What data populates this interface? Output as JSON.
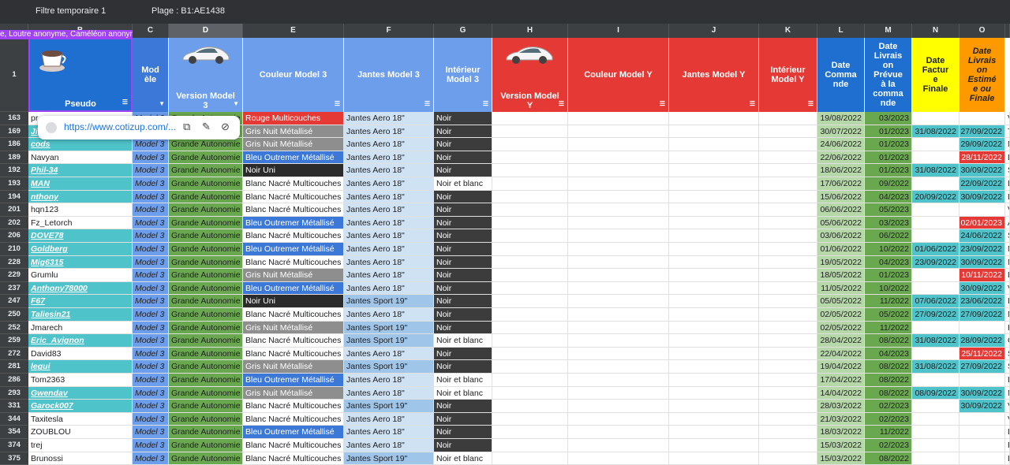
{
  "topbar": {
    "filter_label": "Filtre temporaire 1",
    "range_label": "Plage :   B1:AE1438"
  },
  "collaborators_chip": "e, Loutre anonyme, Caméléon anonyme",
  "col_letters": [
    "",
    "B",
    "C",
    "D",
    "E",
    "F",
    "G",
    "H",
    "I",
    "J",
    "K",
    "L",
    "M",
    "N",
    "O",
    ""
  ],
  "header_row_number": "1",
  "headers": {
    "pseudo": "Pseudo",
    "modele": "Mod\nèle",
    "version3": "Version Model\n3",
    "couleur3": "Couleur Model 3",
    "jantes3": "Jantes Model 3",
    "interieur3": "Intérieur\nModel 3",
    "versionY": "Version Model\nY",
    "couleurY": "Couleur Model Y",
    "jantesY": "Jantes Model Y",
    "interieurY": "Intérieur\nModel Y",
    "dateCmd": "Date\nComma\nnde",
    "dateLivPrev": "Date\nLivrais\non\nPrévue\nà la\ncomma\nnde",
    "dateFact": "Date\nFactur\ne\nFinale",
    "dateLivEst": "Date\nLivrais\non\nEstimé\ne ou\nFinale"
  },
  "popup": {
    "url": "https://www.cotizup.com/..."
  },
  "rows": [
    {
      "n": "163",
      "pseudo": "pr",
      "link": false,
      "m": "Model 3",
      "v": "Grande Autonomie",
      "c": "Rouge Multicouches",
      "cc": "#e53935",
      "cw": true,
      "j": "Jantes Aero 18\"",
      "jc": "#cfe2f3",
      "i": "Noir",
      "ic": "#3c3c3c",
      "iw": true,
      "dc": "19/08/2022",
      "dl": "03/2023",
      "df": "",
      "dfc": "",
      "de": "",
      "dec": "",
      "x": "V"
    },
    {
      "n": "169",
      "pseudo": "Ji",
      "link": true,
      "m": "Model 3",
      "v": "Grande Autonomie",
      "c": "Gris Nuit Métallisé",
      "cc": "#8e8e8e",
      "cw": true,
      "j": "Jantes Aero 18\"",
      "jc": "#cfe2f3",
      "i": "Noir",
      "ic": "#3c3c3c",
      "iw": true,
      "dc": "30/07/2022",
      "dl": "01/2023",
      "df": "31/08/2022",
      "dfc": "#4ec3c9",
      "de": "27/09/2022",
      "dec": "#4ec3c9",
      "x": "T"
    },
    {
      "n": "186",
      "pseudo": "cods",
      "link": true,
      "m": "Model 3",
      "v": "Grande Autonomie",
      "c": "Gris Nuit Métallisé",
      "cc": "#8e8e8e",
      "cw": true,
      "j": "Jantes Aero 18\"",
      "jc": "#cfe2f3",
      "i": "Noir",
      "ic": "#3c3c3c",
      "iw": true,
      "dc": "24/06/2022",
      "dl": "01/2023",
      "df": "",
      "dfc": "",
      "de": "29/09/2022",
      "dec": "#4ec3c9",
      "x": "M"
    },
    {
      "n": "189",
      "pseudo": "Navyan",
      "link": false,
      "m": "Model 3",
      "v": "Grande Autonomie",
      "c": "Bleu Outremer Métallisé",
      "cc": "#3c78d8",
      "cw": true,
      "j": "Jantes Aero 18\"",
      "jc": "#cfe2f3",
      "i": "Noir",
      "ic": "#3c3c3c",
      "iw": true,
      "dc": "22/06/2022",
      "dl": "01/2023",
      "df": "",
      "dfc": "",
      "de": "28/11/2022",
      "dec": "#e53935",
      "x": "L"
    },
    {
      "n": "192",
      "pseudo": "Phil-34",
      "link": true,
      "m": "Model 3",
      "v": "Grande Autonomie",
      "c": "Noir Uni",
      "cc": "#2b2b2b",
      "cw": true,
      "j": "Jantes Aero 18\"",
      "jc": "#cfe2f3",
      "i": "Noir",
      "ic": "#3c3c3c",
      "iw": true,
      "dc": "18/06/2022",
      "dl": "01/2023",
      "df": "31/08/2022",
      "dfc": "#4ec3c9",
      "de": "30/09/2022",
      "dec": "#4ec3c9",
      "x": "S"
    },
    {
      "n": "193",
      "pseudo": "MAN",
      "link": true,
      "m": "Model 3",
      "v": "Grande Autonomie",
      "c": "Blanc Nacré Multicouches",
      "cc": "#ffffff",
      "cw": false,
      "j": "Jantes Aero 18\"",
      "jc": "#cfe2f3",
      "i": "Noir et blanc",
      "ic": "#ffffff",
      "iw": false,
      "dc": "17/06/2022",
      "dl": "09/2022",
      "df": "",
      "dfc": "",
      "de": "22/09/2022",
      "dec": "#4ec3c9",
      "x": "L"
    },
    {
      "n": "194",
      "pseudo": "nthony",
      "link": true,
      "m": "Model 3",
      "v": "Grande Autonomie",
      "c": "Blanc Nacré Multicouches",
      "cc": "#ffffff",
      "cw": false,
      "j": "Jantes Aero 18\"",
      "jc": "#cfe2f3",
      "i": "Noir",
      "ic": "#3c3c3c",
      "iw": true,
      "dc": "15/06/2022",
      "dl": "04/2023",
      "df": "20/09/2022",
      "dfc": "#4ec3c9",
      "de": "30/09/2022",
      "dec": "#4ec3c9",
      "x": "L"
    },
    {
      "n": "201",
      "pseudo": "hqn123",
      "link": false,
      "m": "Model 3",
      "v": "Grande Autonomie",
      "c": "Blanc Nacré Multicouches",
      "cc": "#ffffff",
      "cw": false,
      "j": "Jantes Aero 18\"",
      "jc": "#cfe2f3",
      "i": "Noir",
      "ic": "#3c3c3c",
      "iw": true,
      "dc": "06/06/2022",
      "dl": "05/2023",
      "df": "",
      "dfc": "",
      "de": "",
      "dec": "",
      "x": "V"
    },
    {
      "n": "202",
      "pseudo": "Fz_Letorch",
      "link": false,
      "m": "Model 3",
      "v": "Grande Autonomie",
      "c": "Bleu Outremer Métallisé",
      "cc": "#3c78d8",
      "cw": true,
      "j": "Jantes Aero 18\"",
      "jc": "#cfe2f3",
      "i": "Noir",
      "ic": "#3c3c3c",
      "iw": true,
      "dc": "05/06/2022",
      "dl": "03/2023",
      "df": "",
      "dfc": "",
      "de": "02/01/2023",
      "dec": "#e53935",
      "x": "A"
    },
    {
      "n": "206",
      "pseudo": "DOVE78",
      "link": true,
      "m": "Model 3",
      "v": "Grande Autonomie",
      "c": "Blanc Nacré Multicouches",
      "cc": "#ffffff",
      "cw": false,
      "j": "Jantes Aero 18\"",
      "jc": "#cfe2f3",
      "i": "Noir",
      "ic": "#3c3c3c",
      "iw": true,
      "dc": "03/06/2022",
      "dl": "06/2022",
      "df": "",
      "dfc": "",
      "de": "24/06/2022",
      "dec": "#4ec3c9",
      "x": "S"
    },
    {
      "n": "210",
      "pseudo": "Goldberg",
      "link": true,
      "m": "Model 3",
      "v": "Grande Autonomie",
      "c": "Bleu Outremer Métallisé",
      "cc": "#3c78d8",
      "cw": true,
      "j": "Jantes Aero 18\"",
      "jc": "#cfe2f3",
      "i": "Noir",
      "ic": "#3c3c3c",
      "iw": true,
      "dc": "01/06/2022",
      "dl": "10/2022",
      "df": "01/06/2022",
      "dfc": "#4ec3c9",
      "de": "23/09/2022",
      "dec": "#4ec3c9",
      "x": "N"
    },
    {
      "n": "228",
      "pseudo": "Mig6315",
      "link": true,
      "m": "Model 3",
      "v": "Grande Autonomie",
      "c": "Blanc Nacré Multicouches",
      "cc": "#ffffff",
      "cw": false,
      "j": "Jantes Aero 18\"",
      "jc": "#cfe2f3",
      "i": "Noir",
      "ic": "#3c3c3c",
      "iw": true,
      "dc": "19/05/2022",
      "dl": "04/2023",
      "df": "23/09/2022",
      "dfc": "#4ec3c9",
      "de": "30/09/2022",
      "dec": "#4ec3c9",
      "x": "N"
    },
    {
      "n": "229",
      "pseudo": "Grumlu",
      "link": false,
      "m": "Model 3",
      "v": "Grande Autonomie",
      "c": "Gris Nuit Métallisé",
      "cc": "#8e8e8e",
      "cw": true,
      "j": "Jantes Aero 18\"",
      "jc": "#cfe2f3",
      "i": "Noir",
      "ic": "#3c3c3c",
      "iw": true,
      "dc": "18/05/2022",
      "dl": "01/2023",
      "df": "",
      "dfc": "",
      "de": "10/11/2022",
      "dec": "#e53935",
      "x": "L"
    },
    {
      "n": "237",
      "pseudo": "Anthony78000",
      "link": true,
      "m": "Model 3",
      "v": "Grande Autonomie",
      "c": "Bleu Outremer Métallisé",
      "cc": "#3c78d8",
      "cw": true,
      "j": "Jantes Aero 18\"",
      "jc": "#cfe2f3",
      "i": "Noir",
      "ic": "#3c3c3c",
      "iw": true,
      "dc": "11/05/2022",
      "dl": "10/2022",
      "df": "",
      "dfc": "",
      "de": "30/09/2022",
      "dec": "#4ec3c9",
      "x": "V"
    },
    {
      "n": "247",
      "pseudo": "F67",
      "link": true,
      "m": "Model 3",
      "v": "Grande Autonomie",
      "c": "Noir Uni",
      "cc": "#2b2b2b",
      "cw": true,
      "j": "Jantes Sport 19\"",
      "jc": "#9fc5e8",
      "i": "Noir",
      "ic": "#3c3c3c",
      "iw": true,
      "dc": "05/05/2022",
      "dl": "11/2022",
      "df": "07/06/2022",
      "dfc": "#4ec3c9",
      "de": "23/06/2022",
      "dec": "#4ec3c9",
      "x": "L"
    },
    {
      "n": "250",
      "pseudo": "Taliesin21",
      "link": true,
      "m": "Model 3",
      "v": "Grande Autonomie",
      "c": "Blanc Nacré Multicouches",
      "cc": "#ffffff",
      "cw": false,
      "j": "Jantes Aero 18\"",
      "jc": "#cfe2f3",
      "i": "Noir",
      "ic": "#3c3c3c",
      "iw": true,
      "dc": "02/05/2022",
      "dl": "05/2022",
      "df": "27/09/2022",
      "dfc": "#4ec3c9",
      "de": "27/09/2022",
      "dec": "#4ec3c9",
      "x": "N"
    },
    {
      "n": "252",
      "pseudo": "Jmarech",
      "link": false,
      "m": "Model 3",
      "v": "Grande Autonomie",
      "c": "Gris Nuit Métallisé",
      "cc": "#8e8e8e",
      "cw": true,
      "j": "Jantes Sport 19\"",
      "jc": "#9fc5e8",
      "i": "Noir",
      "ic": "#3c3c3c",
      "iw": true,
      "dc": "02/05/2022",
      "dl": "11/2022",
      "df": "",
      "dfc": "",
      "de": "",
      "dec": "",
      "x": "H"
    },
    {
      "n": "259",
      "pseudo": "Eric_Avignon",
      "link": true,
      "m": "Model 3",
      "v": "Grande Autonomie",
      "c": "Blanc Nacré Multicouches",
      "cc": "#ffffff",
      "cw": false,
      "j": "Jantes Sport 19\"",
      "jc": "#9fc5e8",
      "i": "Noir et blanc",
      "ic": "#ffffff",
      "iw": false,
      "dc": "28/04/2022",
      "dl": "08/2022",
      "df": "31/08/2022",
      "dfc": "#4ec3c9",
      "de": "28/09/2022",
      "dec": "#4ec3c9",
      "x": "C"
    },
    {
      "n": "272",
      "pseudo": "David83",
      "link": false,
      "m": "Model 3",
      "v": "Grande Autonomie",
      "c": "Blanc Nacré Multicouches",
      "cc": "#ffffff",
      "cw": false,
      "j": "Jantes Aero 18\"",
      "jc": "#cfe2f3",
      "i": "Noir",
      "ic": "#3c3c3c",
      "iw": true,
      "dc": "22/04/2022",
      "dl": "04/2023",
      "df": "",
      "dfc": "",
      "de": "25/11/2022",
      "dec": "#e53935",
      "x": "S"
    },
    {
      "n": "281",
      "pseudo": "legui",
      "link": true,
      "m": "Model 3",
      "v": "Grande Autonomie",
      "c": "Gris Nuit Métallisé",
      "cc": "#8e8e8e",
      "cw": true,
      "j": "Jantes Sport 19\"",
      "jc": "#9fc5e8",
      "i": "Noir",
      "ic": "#3c3c3c",
      "iw": true,
      "dc": "19/04/2022",
      "dl": "08/2022",
      "df": "31/08/2022",
      "dfc": "#4ec3c9",
      "de": "27/09/2022",
      "dec": "#4ec3c9",
      "x": "S"
    },
    {
      "n": "286",
      "pseudo": "Tom2363",
      "link": false,
      "m": "Model 3",
      "v": "Grande Autonomie",
      "c": "Bleu Outremer Métallisé",
      "cc": "#3c78d8",
      "cw": true,
      "j": "Jantes Aero 18\"",
      "jc": "#cfe2f3",
      "i": "Noir et blanc",
      "ic": "#ffffff",
      "iw": false,
      "dc": "17/04/2022",
      "dl": "08/2022",
      "df": "",
      "dfc": "",
      "de": "",
      "dec": "",
      "x": "L"
    },
    {
      "n": "293",
      "pseudo": "Gwendav",
      "link": true,
      "m": "Model 3",
      "v": "Grande Autonomie",
      "c": "Gris Nuit Métallisé",
      "cc": "#8e8e8e",
      "cw": true,
      "j": "Jantes Aero 18\"",
      "jc": "#cfe2f3",
      "i": "Noir et blanc",
      "ic": "#ffffff",
      "iw": false,
      "dc": "14/04/2022",
      "dl": "08/2022",
      "df": "08/09/2022",
      "dfc": "#4ec3c9",
      "de": "30/09/2022",
      "dec": "#4ec3c9",
      "x": "N"
    },
    {
      "n": "331",
      "pseudo": "Garock007",
      "link": true,
      "m": "Model 3",
      "v": "Grande Autonomie",
      "c": "Blanc Nacré Multicouches",
      "cc": "#ffffff",
      "cw": false,
      "j": "Jantes Sport 19\"",
      "jc": "#9fc5e8",
      "i": "Noir",
      "ic": "#3c3c3c",
      "iw": true,
      "dc": "28/03/2022",
      "dl": "02/2023",
      "df": "",
      "dfc": "",
      "de": "30/09/2022",
      "dec": "#4ec3c9",
      "x": "V"
    },
    {
      "n": "344",
      "pseudo": "Taxitesla",
      "link": false,
      "m": "Model 3",
      "v": "Grande Autonomie",
      "c": "Blanc Nacré Multicouches",
      "cc": "#ffffff",
      "cw": false,
      "j": "Jantes Aero 18\"",
      "jc": "#cfe2f3",
      "i": "Noir",
      "ic": "#3c3c3c",
      "iw": true,
      "dc": "21/03/2022",
      "dl": "02/2023",
      "df": "",
      "dfc": "",
      "de": "",
      "dec": "",
      "x": "V"
    },
    {
      "n": "354",
      "pseudo": "ZOUBLOU",
      "link": false,
      "m": "Model 3",
      "v": "Grande Autonomie",
      "c": "Bleu Outremer Métallisé",
      "cc": "#3c78d8",
      "cw": true,
      "j": "Jantes Aero 18\"",
      "jc": "#cfe2f3",
      "i": "Noir",
      "ic": "#3c3c3c",
      "iw": true,
      "dc": "18/03/2022",
      "dl": "11/2022",
      "df": "",
      "dfc": "",
      "de": "",
      "dec": "",
      "x": "L"
    },
    {
      "n": "374",
      "pseudo": "trej",
      "link": false,
      "m": "Model 3",
      "v": "Grande Autonomie",
      "c": "Blanc Nacré Multicouches",
      "cc": "#ffffff",
      "cw": false,
      "j": "Jantes Aero 18\"",
      "jc": "#cfe2f3",
      "i": "Noir",
      "ic": "#3c3c3c",
      "iw": true,
      "dc": "15/03/2022",
      "dl": "02/2023",
      "df": "",
      "dfc": "",
      "de": "",
      "dec": "",
      "x": "F"
    },
    {
      "n": "375",
      "pseudo": "Brunossi",
      "link": false,
      "m": "Model 3",
      "v": "Grande Autonomie",
      "c": "Blanc Nacré Multicouches",
      "cc": "#ffffff",
      "cw": false,
      "j": "Jantes Sport 19\"",
      "jc": "#9fc5e8",
      "i": "Noir et blanc",
      "ic": "#ffffff",
      "iw": false,
      "dc": "15/03/2022",
      "dl": "08/2022",
      "df": "",
      "dfc": "",
      "de": "",
      "dec": "",
      "x": "L"
    }
  ]
}
